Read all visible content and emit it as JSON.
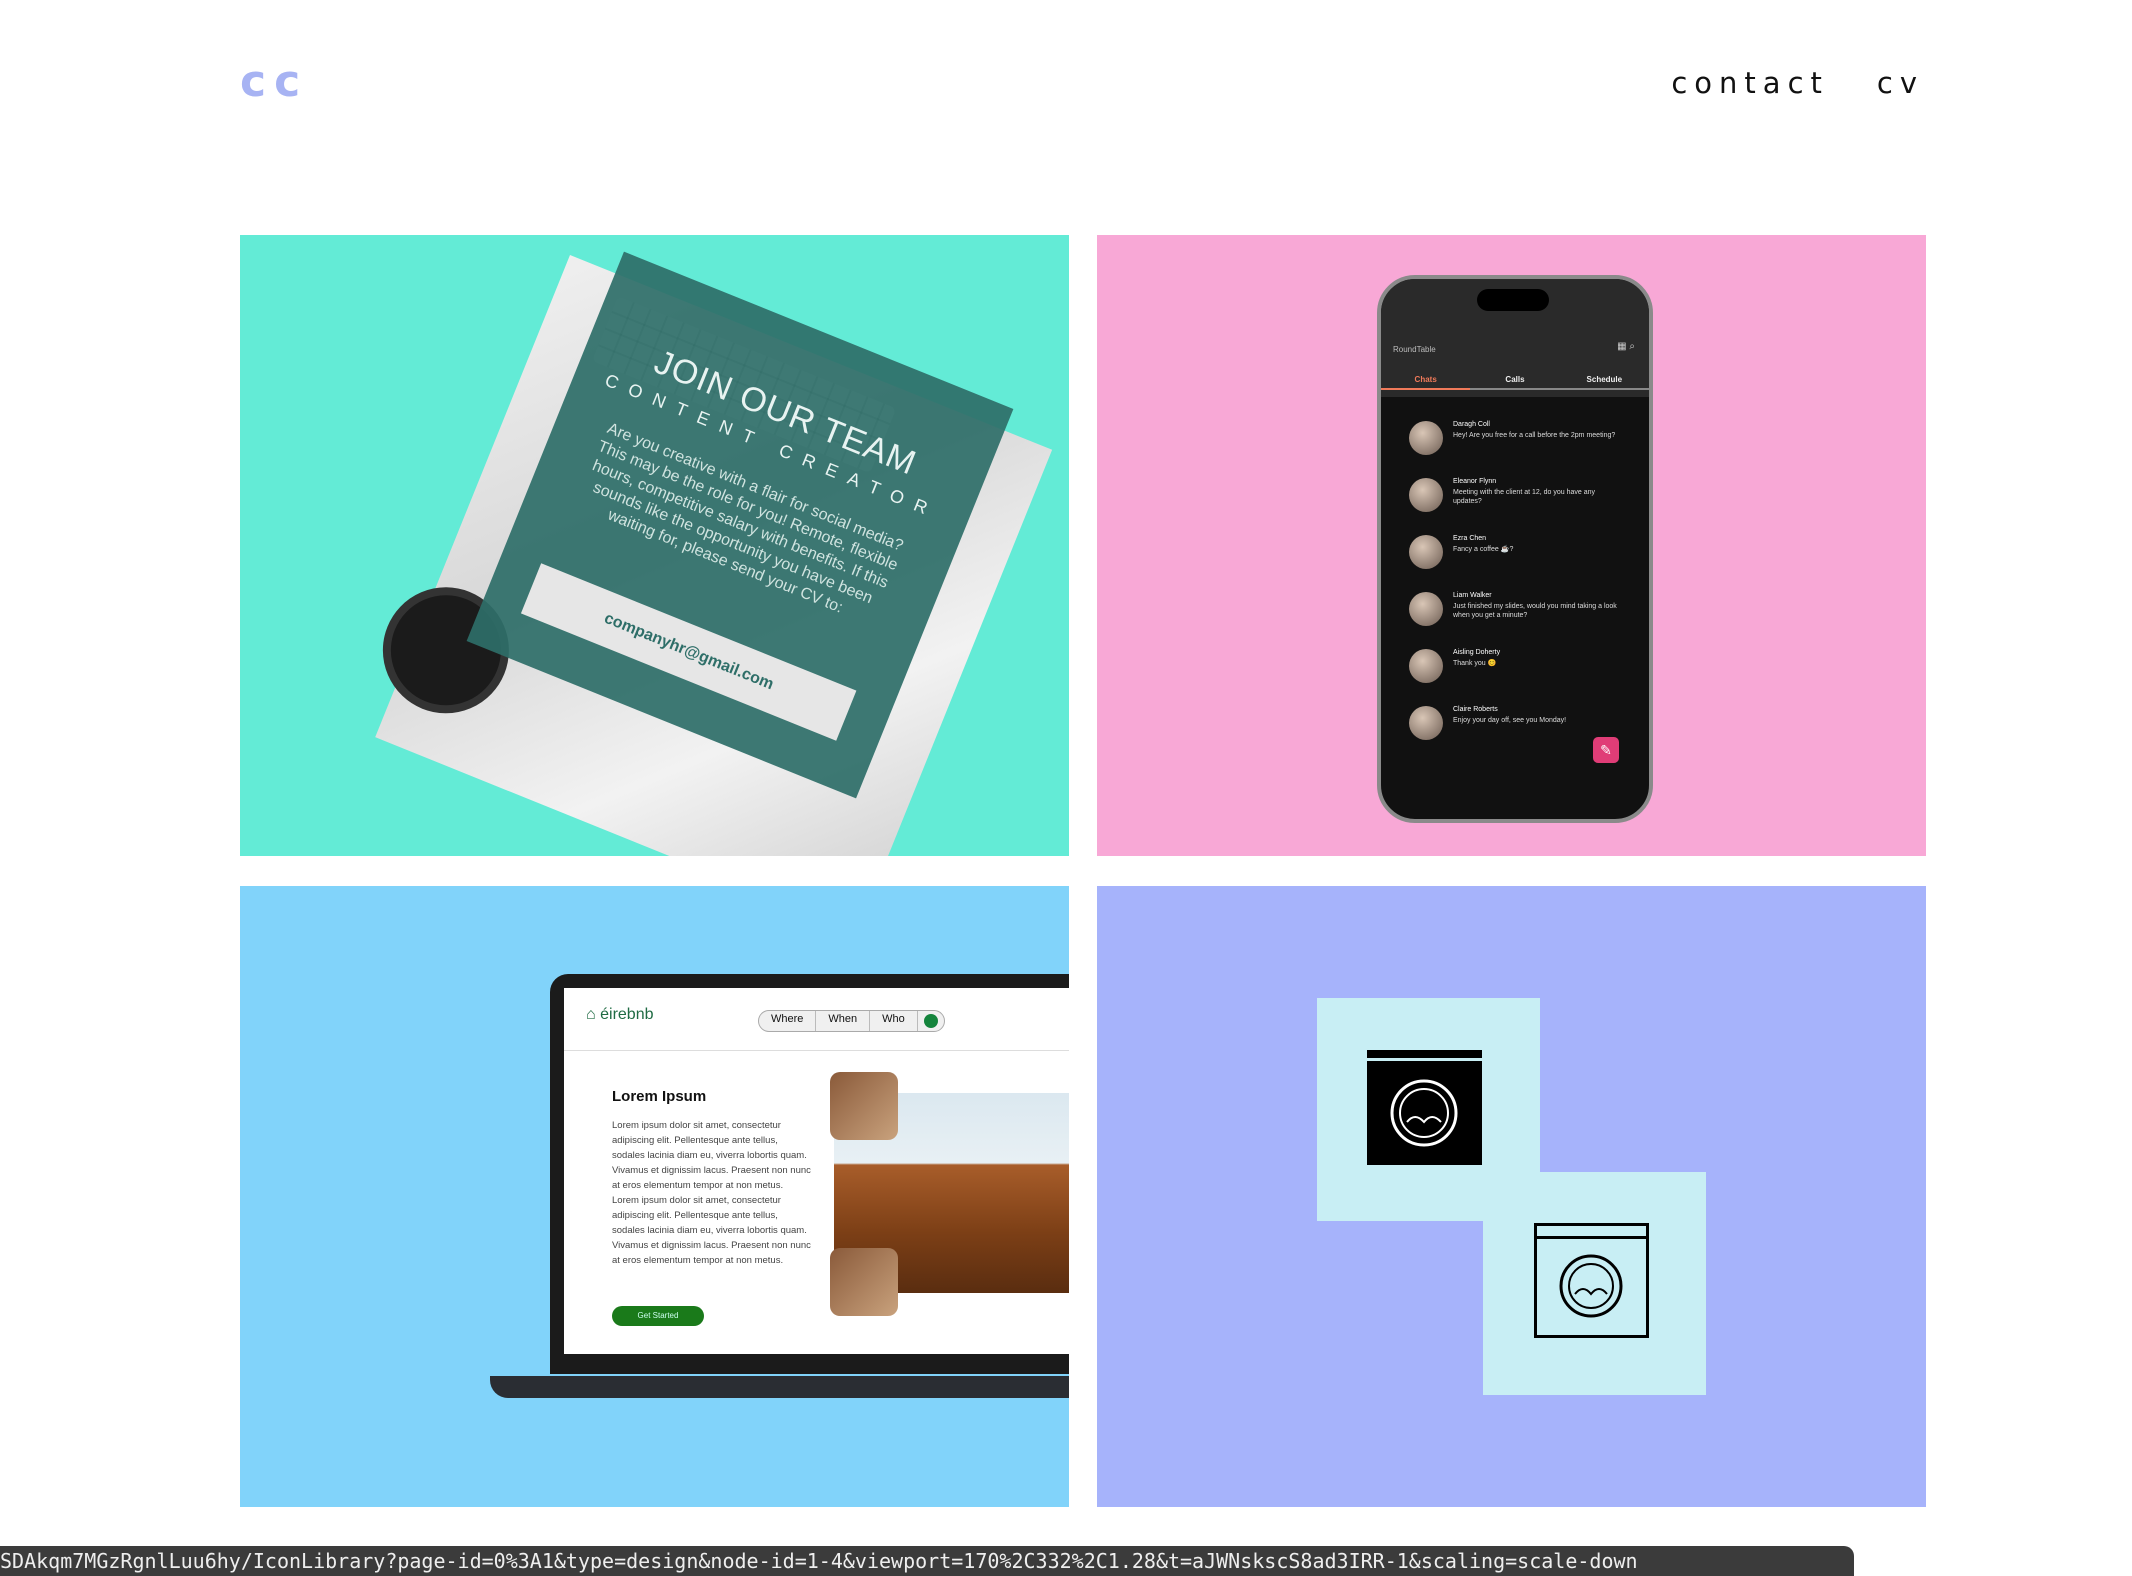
{
  "header": {
    "logo": "cc",
    "nav": [
      {
        "label": "contact"
      },
      {
        "label": "cv"
      }
    ]
  },
  "tiles": {
    "recruitment": {
      "bg": "#63ebd6",
      "title": "JOIN OUR TEAM",
      "subtitle": "CONTENT CREATOR",
      "body": "Are you creative with a flair for social media? This may be the role for you! Remote, flexible hours, competitive salary with benefits. If this sounds like the opportunity you have been waiting for, please send your CV to:",
      "email": "companyhr@gmail.com"
    },
    "chat_app": {
      "bg": "#f8a8d6",
      "app_name": "RoundTable",
      "tabs": [
        "Chats",
        "Calls",
        "Schedule"
      ],
      "active_tab": "Chats",
      "chats": [
        {
          "name": "Daragh Coll",
          "message": "Hey! Are you free for a call before the 2pm meeting?"
        },
        {
          "name": "Eleanor Flynn",
          "message": "Meeting with the client at 12, do you have any updates?"
        },
        {
          "name": "Ezra Chen",
          "message": "Fancy a coffee ☕?"
        },
        {
          "name": "Liam Walker",
          "message": "Just finished my slides, would you mind taking a look when you get a minute?"
        },
        {
          "name": "Aisling Doherty",
          "message": "Thank you 😊"
        },
        {
          "name": "Claire Roberts",
          "message": "Enjoy your day off, see you Monday!"
        }
      ]
    },
    "rental_site": {
      "bg": "#81d3fa",
      "brand": "éirebnb",
      "search": [
        "Where",
        "When",
        "Who"
      ],
      "heading": "Lorem Ipsum",
      "body": "Lorem ipsum dolor sit amet, consectetur adipiscing elit. Pellentesque ante tellus, sodales lacinia diam eu, viverra lobortis quam. Vivamus et dignissim lacus. Praesent non nunc at eros elementum tempor at non metus. Lorem ipsum dolor sit amet, consectetur adipiscing elit. Pellentesque ante tellus, sodales lacinia diam eu, viverra lobortis quam. Vivamus et dignissim lacus. Praesent non nunc at eros elementum tempor at non metus.",
      "cta": "Get Started"
    },
    "icon_library": {
      "bg": "#a6b3fb",
      "icon_fill": "#c8eef4",
      "icons": [
        "washing-machine-icon",
        "washing-machine-outline-icon"
      ]
    }
  },
  "status_bar": {
    "url": "SDAkqm7MGzRgnlLuu6hy/IconLibrary?page-id=0%3A1&type=design&node-id=1-4&viewport=170%2C332%2C1.28&t=aJWNskscS8ad3IRR-1&scaling=scale-down"
  }
}
